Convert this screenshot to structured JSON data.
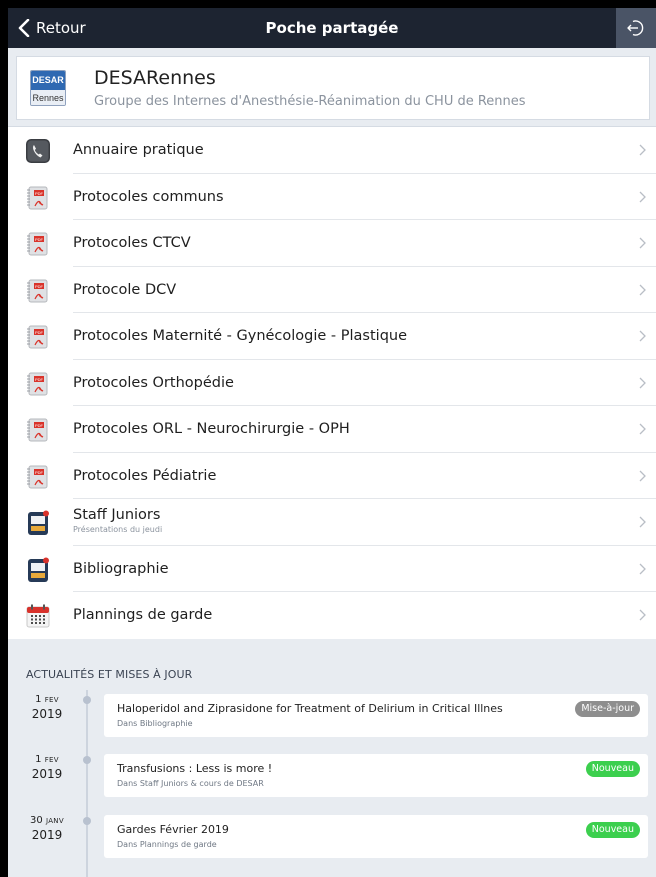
{
  "navbar": {
    "back_label": "Retour",
    "title": "Poche partagée",
    "action_icon": "logout-icon"
  },
  "header": {
    "logo_top": "DESAR",
    "logo_bottom": "Rennes",
    "title": "DESARennes",
    "subtitle": "Groupe des Internes d'Anesthésie-Réanimation du CHU de Rennes"
  },
  "menu": [
    {
      "label": "Annuaire pratique",
      "icon": "phone-icon"
    },
    {
      "label": "Protocoles communs",
      "icon": "pdf-icon"
    },
    {
      "label": "Protocoles CTCV",
      "icon": "pdf-icon"
    },
    {
      "label": "Protocole DCV",
      "icon": "pdf-icon"
    },
    {
      "label": "Protocoles Maternité - Gynécologie - Plastique",
      "icon": "pdf-icon"
    },
    {
      "label": "Protocoles Orthopédie",
      "icon": "pdf-icon"
    },
    {
      "label": "Protocoles ORL - Neurochirurgie - OPH",
      "icon": "pdf-icon"
    },
    {
      "label": "Protocoles Pédiatrie",
      "icon": "pdf-icon"
    },
    {
      "label": "Staff Juniors",
      "sublabel": "Présentations du jeudi",
      "icon": "presentation-icon"
    },
    {
      "label": "Bibliographie",
      "icon": "presentation-icon"
    },
    {
      "label": "Plannings de garde",
      "icon": "calendar-icon"
    }
  ],
  "news": {
    "heading": "ACTUALITÉS ET MISES À JOUR",
    "items": [
      {
        "day": "1",
        "month": "FEV",
        "year": "2019",
        "title": "Haloperidol and Ziprasidone for Treatment of Delirium in Critical Illnes",
        "subtitle": "Dans Bibliographie",
        "badge": "Mise-à-jour"
      },
      {
        "day": "1",
        "month": "FEV",
        "year": "2019",
        "title": "Transfusions : Less is more !",
        "subtitle": "Dans Staff Juniors & cours de DESAR",
        "badge": "Nouveau"
      },
      {
        "day": "30",
        "month": "JANV",
        "year": "2019",
        "title": "Gardes Février 2019",
        "subtitle": "Dans Plannings de garde",
        "badge": "Nouveau"
      }
    ]
  },
  "colors": {
    "navbar_bg": "#1d2431",
    "accent_blue": "#2f69b2",
    "badge_update": "#8e8e8e",
    "badge_new": "#3ccf4e",
    "background": "#e8ecf1"
  }
}
